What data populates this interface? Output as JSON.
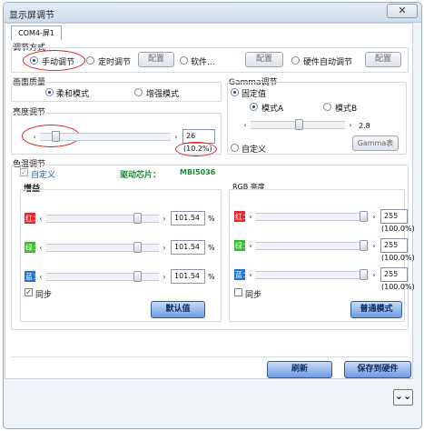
{
  "window": {
    "title": "显示屏调节",
    "close_glyph": "✕"
  },
  "tab": "COM4-屏1",
  "mode": {
    "group_title": "调节方式",
    "manual": "手动调节",
    "timed": "定时调节",
    "config1": "配置",
    "software": "软件...",
    "config2": "配置",
    "hardware": "硬件自动调节",
    "config3": "配置"
  },
  "quality": {
    "group_title": "画面质量",
    "soft": "柔和模式",
    "enhance": "增强模式"
  },
  "brightness": {
    "group_title": "亮度调节",
    "value": "26",
    "percent": "(10.2%)",
    "level_fraction": 0.1
  },
  "gamma": {
    "group_title": "Gamma调节",
    "fixed": "固定值",
    "mode_a": "模式A",
    "mode_b": "模式B",
    "value": "2.8",
    "custom": "自定义",
    "gamma_btn": "Gamma表",
    "level_fraction": 0.52
  },
  "color": {
    "group_title": "色温调节",
    "custom": "自定义",
    "chip_label": "驱动芯片：",
    "chip_value": "MBI5036"
  },
  "gain": {
    "group_title": "增益",
    "rows": [
      {
        "label": "红：",
        "value": "101.54",
        "unit": "%",
        "color": "#e8262a",
        "level": 0.84
      },
      {
        "label": "绿：",
        "value": "101.54",
        "unit": "%",
        "color": "#2fc02a",
        "level": 0.84
      },
      {
        "label": "蓝：",
        "value": "101.54",
        "unit": "%",
        "color": "#1f74d8",
        "level": 0.84
      }
    ],
    "sync": "同步",
    "default_btn": "默认值"
  },
  "rgb": {
    "group_title": "RGB 亮度",
    "rows": [
      {
        "label": "红：",
        "value": "255",
        "percent": "(100.0%)",
        "color": "#e8262a",
        "level": 1.0
      },
      {
        "label": "绿：",
        "value": "255",
        "percent": "(100.0%)",
        "color": "#2fc02a",
        "level": 1.0
      },
      {
        "label": "蓝：",
        "value": "255",
        "percent": "(100.0%)",
        "color": "#1f74d8",
        "level": 1.0
      }
    ],
    "sync": "同步",
    "normal_btn": "普通模式"
  },
  "footer": {
    "refresh": "刷新",
    "save": "保存到硬件",
    "expand_glyph": "⌄⌄"
  }
}
